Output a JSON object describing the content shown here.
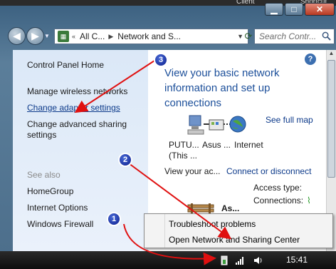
{
  "topbar": {
    "client": "Client",
    "shortcut": "Shortcut"
  },
  "address": {
    "seg1": "All C...",
    "seg2": "Network and S..."
  },
  "search": {
    "placeholder": "Search Contr..."
  },
  "left": {
    "home": "Control Panel Home",
    "wireless": "Manage wireless networks",
    "adapter": "Change adapter settings",
    "sharing_line1": "Change advanced sharing",
    "sharing_line2": "settings",
    "see_also": "See also",
    "homegroup": "HomeGroup",
    "internet_options": "Internet Options",
    "firewall": "Windows Firewall"
  },
  "right": {
    "title_line1": "View your basic network",
    "title_line2": "information and set up",
    "title_line3": "connections",
    "see_full_map": "See full map",
    "node1_line1": "PUTU...",
    "node1_line2": "(This ...",
    "node2": "Asus ...",
    "node3": "Internet",
    "view_active": "View your ac...",
    "connect": "Connect or disconnect",
    "access_type": "Access type:",
    "connections": "Connections:",
    "network_name": "As..."
  },
  "menu": {
    "troubleshoot": "Troubleshoot problems",
    "open_center": "Open Network and Sharing Center"
  },
  "taskbar": {
    "time": "15:41"
  },
  "badges": {
    "b1": "1",
    "b2": "2",
    "b3": "3"
  },
  "colors": {
    "link": "#0d3a8a",
    "title": "#1c4f9a",
    "arrow": "#e01010"
  }
}
